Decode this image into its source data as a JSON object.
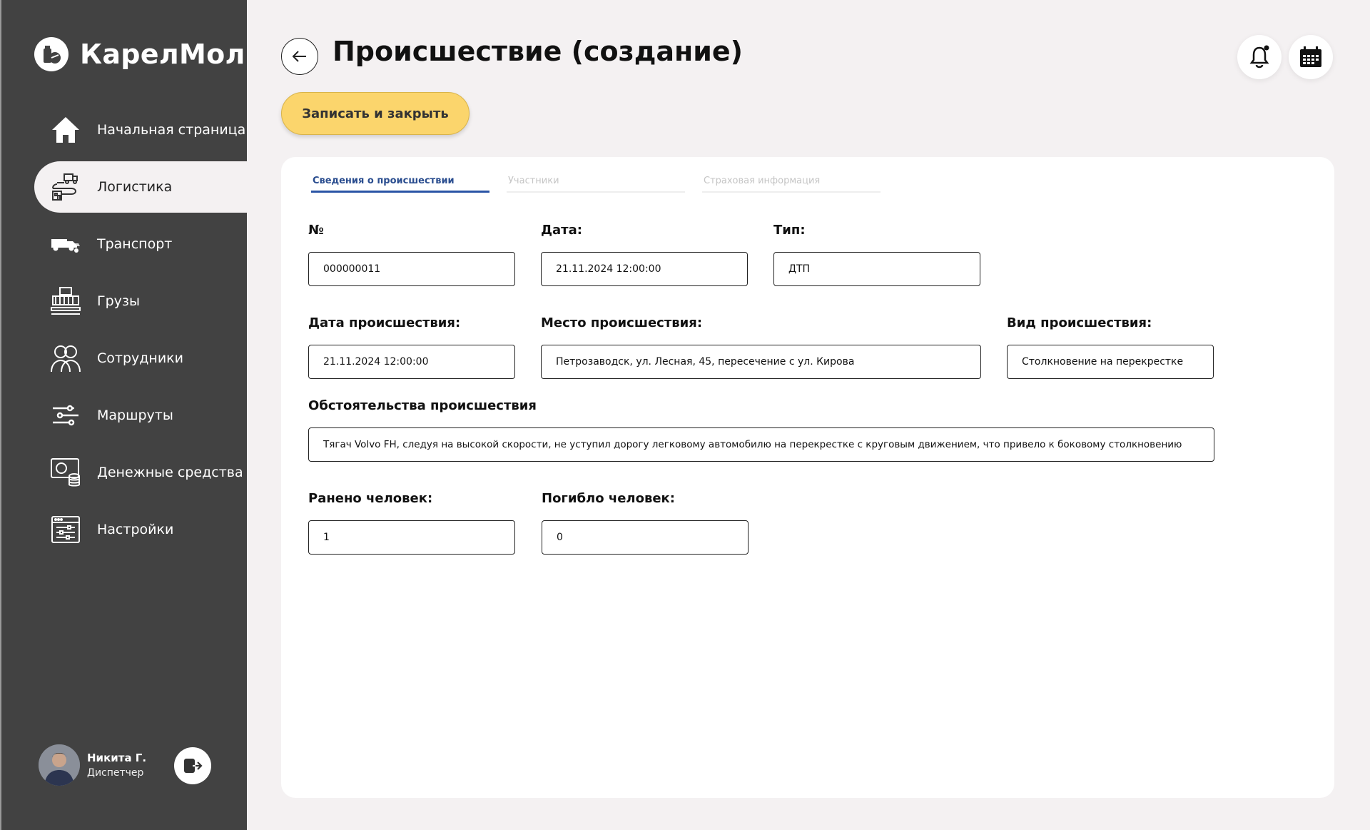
{
  "brand": {
    "name": "КарелМол"
  },
  "sidebar": {
    "items": [
      {
        "label": "Начальная страница",
        "icon": "home-icon"
      },
      {
        "label": "Логистика",
        "icon": "logistics-icon"
      },
      {
        "label": "Транспорт",
        "icon": "transport-icon"
      },
      {
        "label": "Грузы",
        "icon": "cargo-icon"
      },
      {
        "label": "Сотрудники",
        "icon": "employees-icon"
      },
      {
        "label": "Маршруты",
        "icon": "routes-icon"
      },
      {
        "label": "Денежные средства",
        "icon": "money-icon"
      },
      {
        "label": "Настройки",
        "icon": "settings-icon"
      }
    ],
    "active_index": 1
  },
  "user": {
    "name": "Никита Г.",
    "role": "Диспетчер"
  },
  "header": {
    "title": "Происшествие (создание)",
    "save_label": "Записать и закрыть"
  },
  "tabs": [
    {
      "label": "Сведения о происшествии",
      "active": true
    },
    {
      "label": "Участники",
      "active": false
    },
    {
      "label": "Страховая информация",
      "active": false
    }
  ],
  "form": {
    "number": {
      "label": "№",
      "value": "000000011"
    },
    "date": {
      "label": "Дата:",
      "value": "21.11.2024 12:00:00"
    },
    "type": {
      "label": "Тип:",
      "value": "ДТП"
    },
    "incident_date": {
      "label": "Дата происшествия:",
      "value": "21.11.2024 12:00:00"
    },
    "place": {
      "label": "Место происшествия:",
      "value": "Петрозаводск, ул. Лесная, 45, пересечение с ул. Кирова"
    },
    "kind": {
      "label": "Вид происшествия:",
      "value": "Столкновение на перекрестке"
    },
    "circumstances": {
      "label": "Обстоятельства происшествия",
      "value": "Тягач Volvo FH, следуя на высокой скорости, не уступил дорогу легковому автомобилю на перекрестке с круговым движением, что привело к боковому столкновению"
    },
    "injured": {
      "label": "Ранено человек:",
      "value": "1"
    },
    "killed": {
      "label": "Погибло человек:",
      "value": "0"
    }
  },
  "colors": {
    "sidebar_bg": "#424242",
    "page_bg": "#f4f1f2",
    "accent_button": "#fbd56c",
    "active_tab": "#2a54a5"
  }
}
